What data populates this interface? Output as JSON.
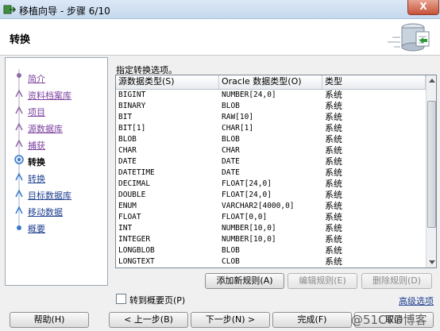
{
  "window": {
    "title": "移植向导 - 步骤 6/10",
    "close_label": "X"
  },
  "header": {
    "title": "转换"
  },
  "nav": {
    "items": [
      {
        "label": "简介",
        "state": "done"
      },
      {
        "label": "资料档案库",
        "state": "done"
      },
      {
        "label": "项目",
        "state": "done"
      },
      {
        "label": "源数据库",
        "state": "done"
      },
      {
        "label": "捕获",
        "state": "done"
      },
      {
        "label": "转换",
        "state": "current"
      },
      {
        "label": "转换",
        "state": "future"
      },
      {
        "label": "目标数据库",
        "state": "future"
      },
      {
        "label": "移动数据",
        "state": "future"
      },
      {
        "label": "概要",
        "state": "future"
      }
    ]
  },
  "main": {
    "instruction": "指定转换选项。",
    "table": {
      "headers": [
        "源数据类型(S)",
        "Oracle 数据类型(O)",
        "类型"
      ],
      "rows": [
        [
          "BIGINT",
          "NUMBER[24,0]",
          "系统"
        ],
        [
          "BINARY",
          "BLOB",
          "系统"
        ],
        [
          "BIT",
          "RAW[10]",
          "系统"
        ],
        [
          "BIT[1]",
          "CHAR[1]",
          "系统"
        ],
        [
          "BLOB",
          "BLOB",
          "系统"
        ],
        [
          "CHAR",
          "CHAR",
          "系统"
        ],
        [
          "DATE",
          "DATE",
          "系统"
        ],
        [
          "DATETIME",
          "DATE",
          "系统"
        ],
        [
          "DECIMAL",
          "FLOAT[24,0]",
          "系统"
        ],
        [
          "DOUBLE",
          "FLOAT[24,0]",
          "系统"
        ],
        [
          "ENUM",
          "VARCHAR2[4000,0]",
          "系统"
        ],
        [
          "FLOAT",
          "FLOAT[0,0]",
          "系统"
        ],
        [
          "INT",
          "NUMBER[10,0]",
          "系统"
        ],
        [
          "INTEGER",
          "NUMBER[10,0]",
          "系统"
        ],
        [
          "LONGBLOB",
          "BLOB",
          "系统"
        ],
        [
          "LONGTEXT",
          "CLOB",
          "系统"
        ]
      ]
    },
    "rule_buttons": {
      "add": "添加新规则(A)",
      "edit": "编辑规则(E)",
      "delete": "删除规则(D)"
    },
    "summary_checkbox": {
      "label": "转到概要页(P)",
      "checked": false
    },
    "advanced_link": "高级选项"
  },
  "footer": {
    "help": "帮助(H)",
    "back": "< 上一步(B)",
    "next": "下一步(N) >",
    "finish": "完成(F)",
    "cancel": "取消"
  },
  "watermark": "@51CTO博客",
  "colors": {
    "visited_link": "#7b3f9e",
    "future_link": "#1f3f8f",
    "accent_blue": "#3a78c9"
  },
  "icons": {
    "nav_done": "pushpin-step-icon",
    "nav_current": "current-step-icon",
    "nav_future": "blue-step-icon",
    "header": "database-migration-icon"
  }
}
